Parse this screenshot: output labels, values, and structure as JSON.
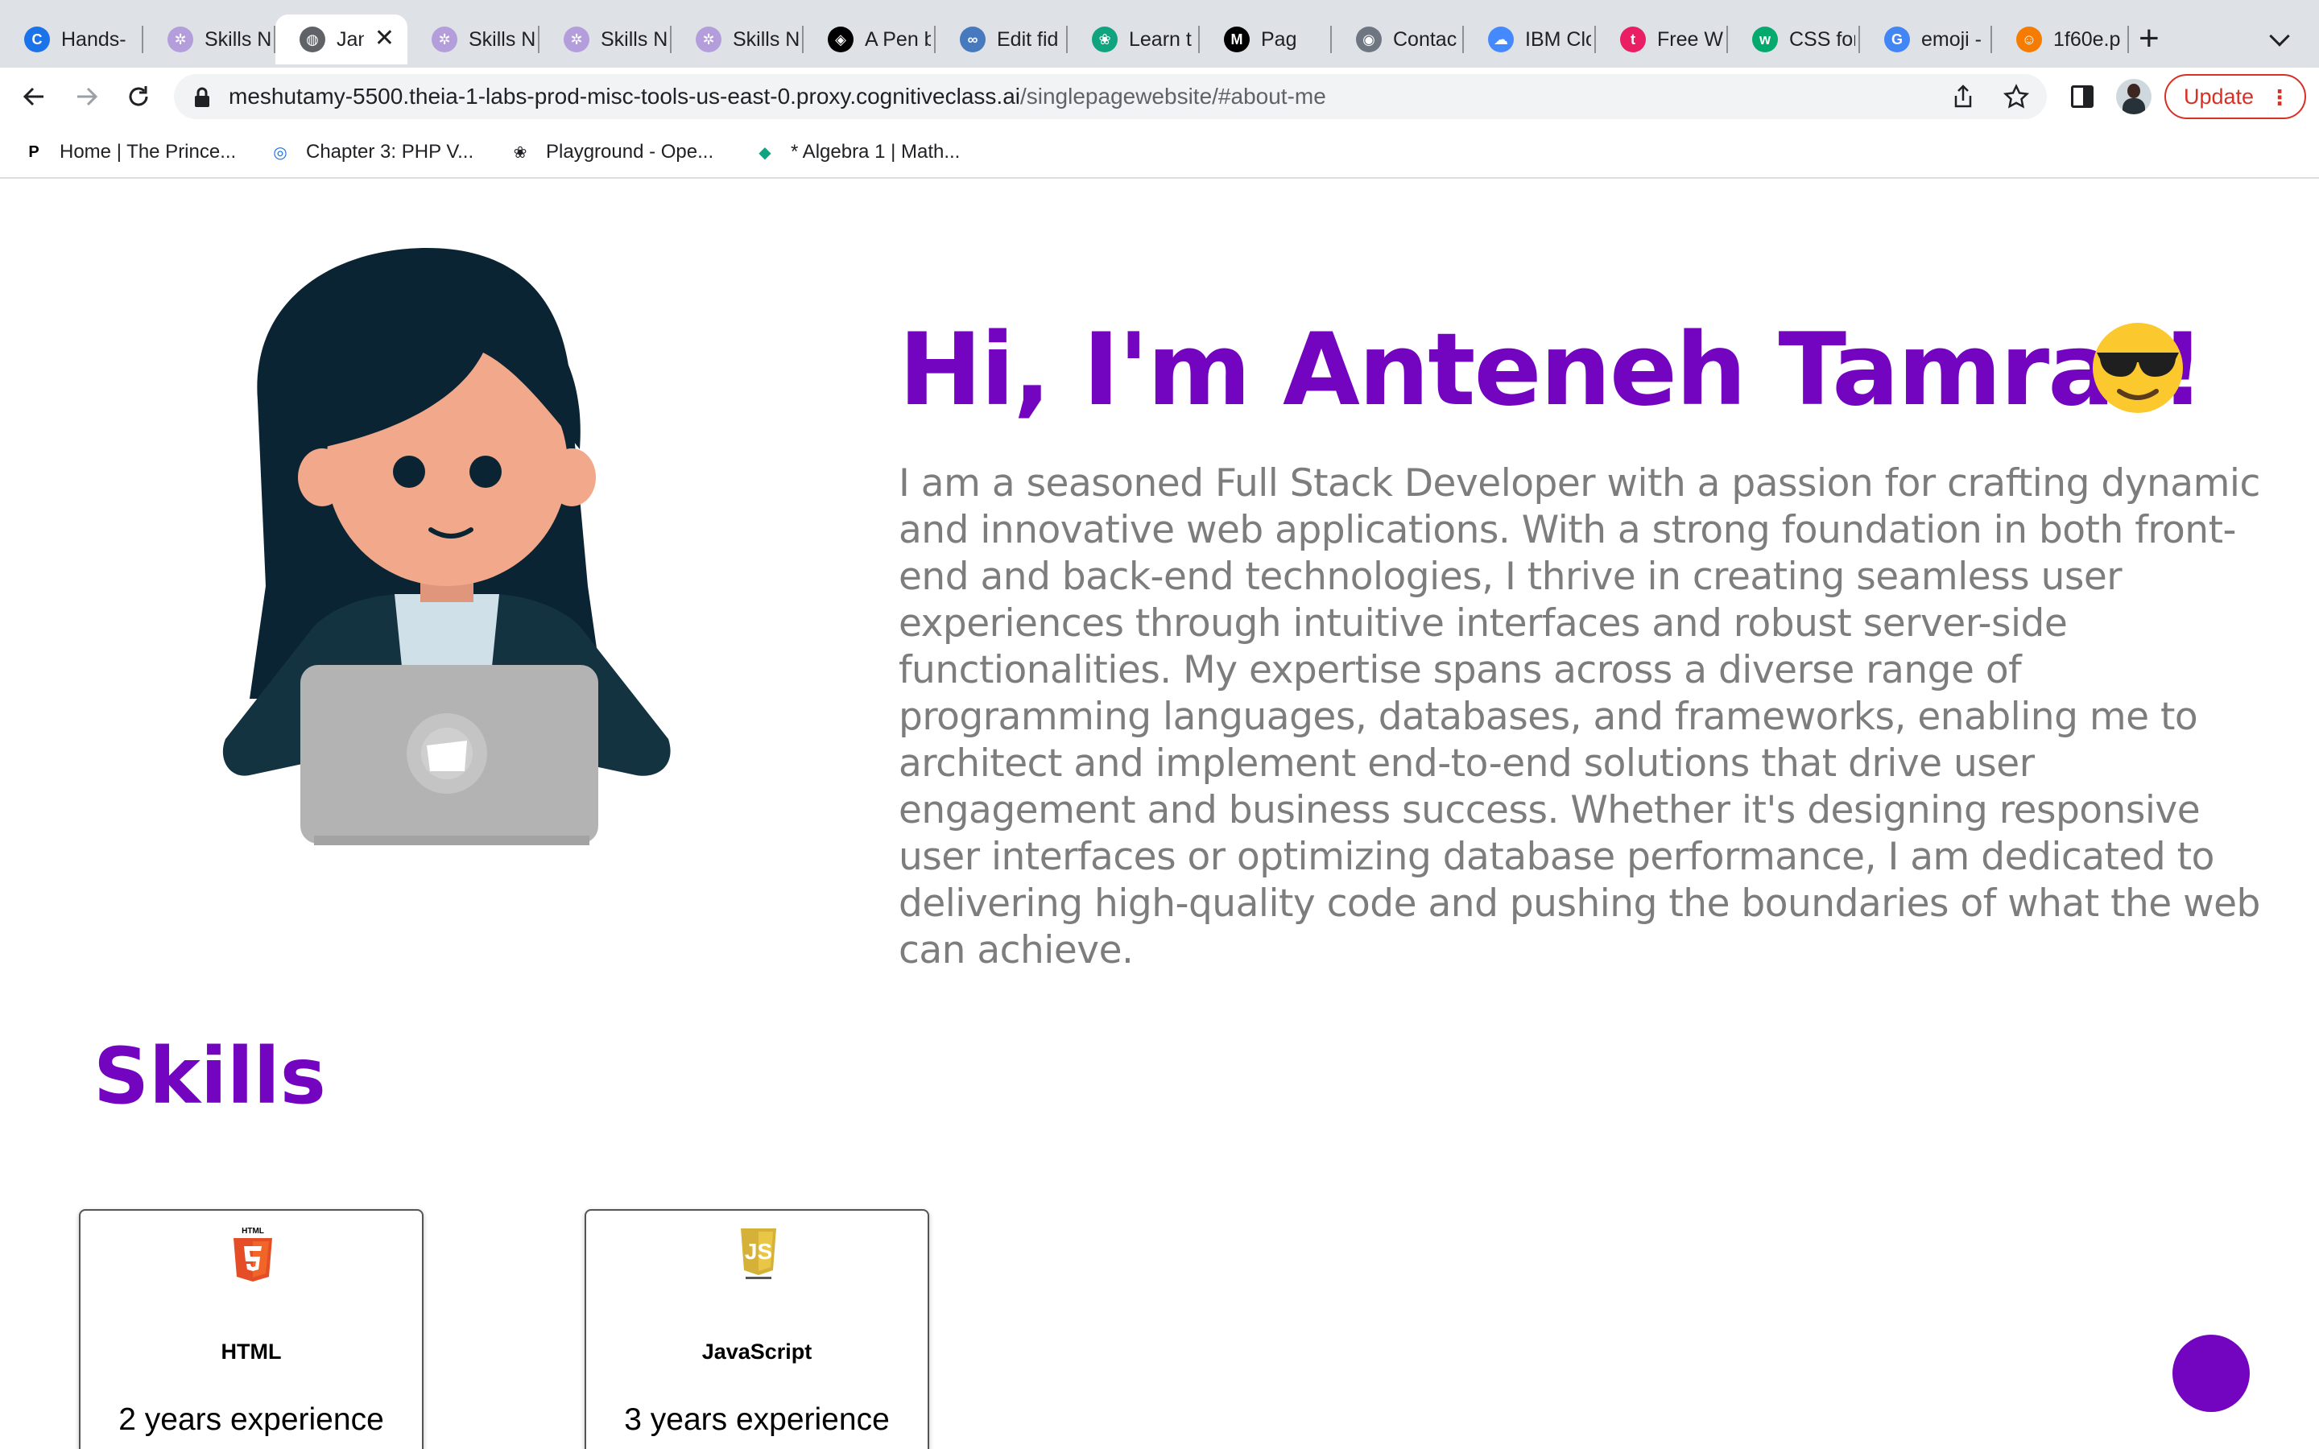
{
  "browser": {
    "tabs": [
      {
        "title": "Hands-",
        "icon": "coursera-icon",
        "color": "#1a73e8",
        "glyph": "C"
      },
      {
        "title": "Skills N",
        "icon": "skills-network-icon",
        "color": "#b39ddb",
        "glyph": "✲"
      },
      {
        "title": "Jan",
        "icon": "globe-icon",
        "color": "#5f6368",
        "glyph": "◍",
        "active": true
      },
      {
        "title": "Skills N",
        "icon": "skills-network-icon",
        "color": "#b39ddb",
        "glyph": "✲"
      },
      {
        "title": "Skills N",
        "icon": "skills-network-icon",
        "color": "#b39ddb",
        "glyph": "✲"
      },
      {
        "title": "Skills N",
        "icon": "skills-network-icon",
        "color": "#b39ddb",
        "glyph": "✲"
      },
      {
        "title": "A Pen b",
        "icon": "codepen-icon",
        "color": "#000000",
        "glyph": "◈"
      },
      {
        "title": "Edit fid",
        "icon": "jsfiddle-icon",
        "color": "#4679bd",
        "glyph": "∞"
      },
      {
        "title": "Learn t",
        "icon": "openai-icon",
        "color": "#10a37f",
        "glyph": "❀"
      },
      {
        "title": "Pag",
        "icon": "medium-icon",
        "color": "#000000",
        "glyph": "M"
      },
      {
        "title": "Contac",
        "icon": "github-icon",
        "color": "#6e7681",
        "glyph": "◉"
      },
      {
        "title": "IBM Clo",
        "icon": "ibm-cloud-icon",
        "color": "#4589ff",
        "glyph": "☁"
      },
      {
        "title": "Free W",
        "icon": "free-web-icon",
        "color": "#e91e63",
        "glyph": "t"
      },
      {
        "title": "CSS for",
        "icon": "w3schools-icon",
        "color": "#04aa6d",
        "glyph": "w"
      },
      {
        "title": "emoji -",
        "icon": "google-icon",
        "color": "#4285f4",
        "glyph": "G"
      },
      {
        "title": "1f60e.p",
        "icon": "image-icon",
        "color": "#f57c00",
        "glyph": "☺"
      }
    ],
    "url": {
      "host": "meshutamy-5500.theia-1-labs-prod-misc-tools-us-east-0.proxy.cognitiveclass.ai",
      "path": "/singlepagewebsite/#about-me"
    },
    "update_label": "Update",
    "bookmarks": [
      {
        "label": "Home | The Prince...",
        "icon": "princeton-review-icon",
        "color": "#000000",
        "glyph": "P"
      },
      {
        "label": "Chapter 3: PHP V...",
        "icon": "chapter-icon",
        "color": "#1a73e8",
        "glyph": "◎"
      },
      {
        "label": "Playground - Ope...",
        "icon": "openai-icon",
        "color": "#202124",
        "glyph": "❀"
      },
      {
        "label": "* Algebra 1 | Math...",
        "icon": "math-icon",
        "color": "#10a37f",
        "glyph": "◆"
      }
    ]
  },
  "page": {
    "hero": {
      "title": "Hi, I'm Anteneh Tamrat!",
      "emoji_icon": "sunglasses-face-icon",
      "bio": "I am a seasoned Full Stack Developer with a passion for crafting dynamic and innovative web applications. With a strong foundation in both front-end and back-end technologies, I thrive in creating seamless user experiences through intuitive interfaces and robust server-side functionalities. My expertise spans across a diverse range of programming languages, databases, and frameworks, enabling me to architect and implement end-to-end solutions that drive user engagement and business success. Whether it's designing responsive user interfaces or optimizing database performance, I am dedicated to delivering high-quality code and pushing the boundaries of what the web can achieve."
    },
    "skills": {
      "heading": "Skills",
      "items": [
        {
          "name": "HTML",
          "experience": "2 years experience",
          "icon": "html5-icon"
        },
        {
          "name": "JavaScript",
          "experience": "3 years experience",
          "icon": "javascript-icon"
        }
      ]
    },
    "accent_color": "#7305c1",
    "text_color": "#7d7d7d"
  }
}
